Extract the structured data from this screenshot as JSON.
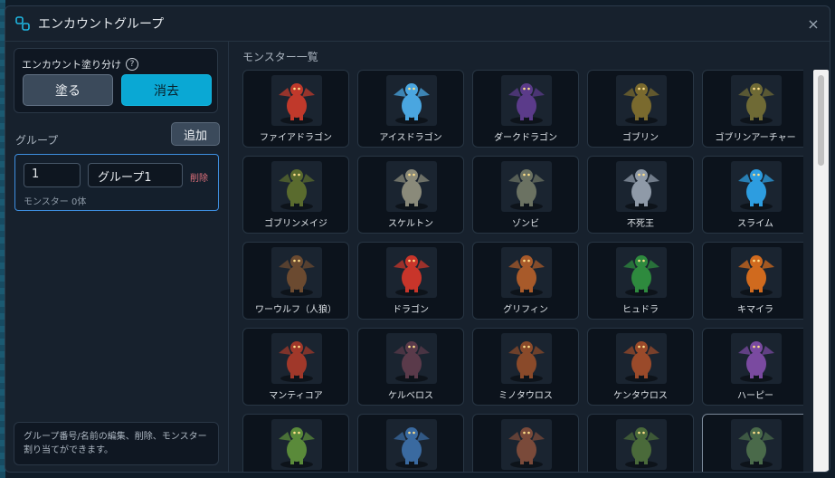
{
  "dialog": {
    "title": "エンカウントグループ",
    "close_glyph": "×"
  },
  "paint": {
    "label": "エンカウント塗り分け",
    "help_glyph": "?",
    "paint_button": "塗る",
    "erase_button": "消去"
  },
  "groups": {
    "heading": "グループ",
    "add_button": "追加",
    "items": [
      {
        "number": "1",
        "name": "グループ1",
        "delete_label": "削除",
        "count_text": "モンスター 0体"
      }
    ]
  },
  "help_text": "グループ番号/名前の編集、削除、モンスター割り当てができます。",
  "monster_list": {
    "title": "モンスター一覧",
    "monsters": [
      {
        "name": "ファイアドラゴン",
        "icon": "fire-dragon-sprite",
        "color": "#c0392b"
      },
      {
        "name": "アイスドラゴン",
        "icon": "ice-dragon-sprite",
        "color": "#4aa6e0"
      },
      {
        "name": "ダークドラゴン",
        "icon": "dark-dragon-sprite",
        "color": "#5b3b8a"
      },
      {
        "name": "ゴブリン",
        "icon": "goblin-sprite",
        "color": "#7a6a2e"
      },
      {
        "name": "ゴブリンアーチャー",
        "icon": "goblin-archer-sprite",
        "color": "#6f6a35"
      },
      {
        "name": "ゴブリンメイジ",
        "icon": "goblin-mage-sprite",
        "color": "#5a6b2e"
      },
      {
        "name": "スケルトン",
        "icon": "skeleton-sprite",
        "color": "#8a8a7a"
      },
      {
        "name": "ゾンビ",
        "icon": "zombie-sprite",
        "color": "#6b7262"
      },
      {
        "name": "不死王",
        "icon": "undead-king-sprite",
        "color": "#8f9aa8"
      },
      {
        "name": "スライム",
        "icon": "slime-sprite",
        "color": "#2d9de0"
      },
      {
        "name": "ワーウルフ（人狼）",
        "icon": "werewolf-sprite",
        "color": "#6b4a30"
      },
      {
        "name": "ドラゴン",
        "icon": "dragon-sprite",
        "color": "#c8352a"
      },
      {
        "name": "グリフィン",
        "icon": "griffin-sprite",
        "color": "#a85a2a"
      },
      {
        "name": "ヒュドラ",
        "icon": "hydra-sprite",
        "color": "#2e8a3e"
      },
      {
        "name": "キマイラ",
        "icon": "chimera-sprite",
        "color": "#d06a1e"
      },
      {
        "name": "マンティコア",
        "icon": "manticore-sprite",
        "color": "#a0382a"
      },
      {
        "name": "ケルベロス",
        "icon": "cerberus-sprite",
        "color": "#5a3a4a"
      },
      {
        "name": "ミノタウロス",
        "icon": "minotaur-sprite",
        "color": "#8a4a2a"
      },
      {
        "name": "ケンタウロス",
        "icon": "centaur-sprite",
        "color": "#9a4a2a"
      },
      {
        "name": "ハーピー",
        "icon": "harpy-sprite",
        "color": "#7a4aa0"
      },
      {
        "name": "",
        "icon": "orc-sprite",
        "color": "#5a8a3a"
      },
      {
        "name": "",
        "icon": "bird-beast-sprite",
        "color": "#3a6aa0"
      },
      {
        "name": "",
        "icon": "brute-sprite",
        "color": "#7a4a3a"
      },
      {
        "name": "",
        "icon": "ghoul-sprite",
        "color": "#4a6a3a"
      },
      {
        "name": "",
        "icon": "zombie-walker-sprite",
        "color": "#4a6a4a"
      }
    ],
    "selected_index": 24
  }
}
